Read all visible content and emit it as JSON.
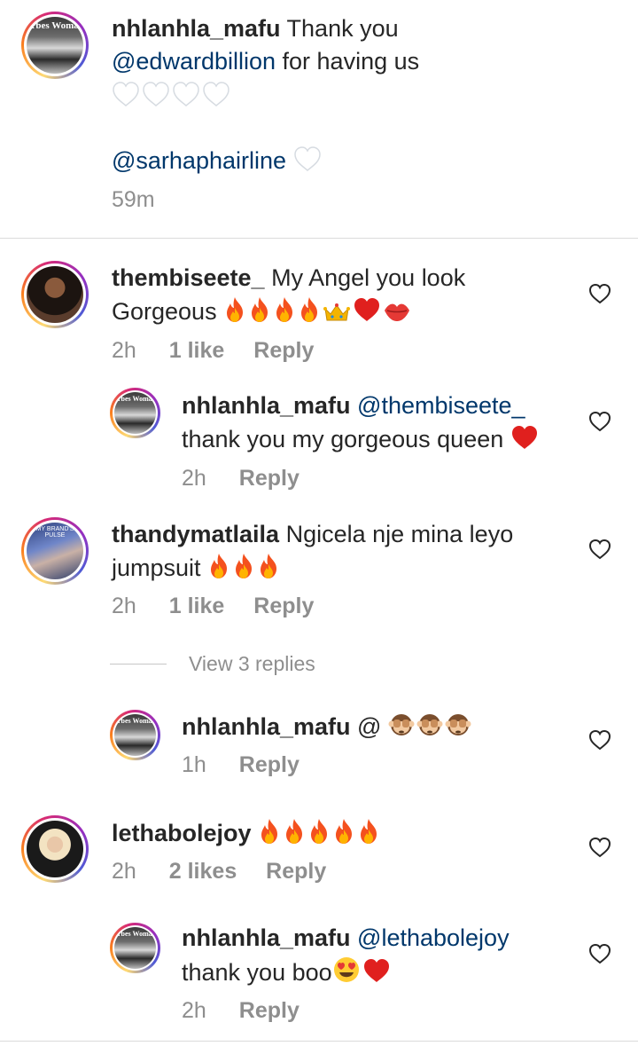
{
  "top_comment": {
    "username": "nhlanhla_mafu",
    "text_start": "Thank you",
    "mention": "@edwardbillion",
    "text_end": "for having us",
    "emoji_line": [
      "white-heart",
      "white-heart",
      "white-heart",
      "white-heart"
    ],
    "mention2": "@sarhaphairline",
    "emoji_after_mention2": "white-heart",
    "time": "59m",
    "avatar_masthead": "orbes Woman"
  },
  "comments": [
    {
      "username": "thembiseete_",
      "text_line1": "My Angel you look",
      "text_line2": "Gorgeous",
      "emojis": [
        "fire",
        "fire",
        "fire",
        "fire",
        "crown",
        "red-heart",
        "kiss"
      ],
      "time": "2h",
      "likes": "1 like",
      "reply_label": "Reply"
    },
    {
      "username": "nhlanhla_mafu",
      "mention": "@thembiseete_",
      "text_line2": "thank you my gorgeous queen",
      "emojis": [
        "red-heart"
      ],
      "time": "2h",
      "reply_label": "Reply",
      "avatar_masthead": "orbes Woman"
    },
    {
      "username": "thandymatlaila",
      "text_line1": "Ngicela nje mina leyo",
      "text_line2": "jumpsuit",
      "emojis": [
        "fire",
        "fire",
        "fire"
      ],
      "time": "2h",
      "likes": "1 like",
      "reply_label": "Reply",
      "avatar_masthead": "MY BRAND'S PULSE"
    },
    {
      "view_replies": "View 3 replies"
    },
    {
      "username": "nhlanhla_mafu",
      "text_line1": "@",
      "emojis": [
        "see-no-evil-monkey",
        "see-no-evil-monkey",
        "see-no-evil-monkey"
      ],
      "time": "1h",
      "reply_label": "Reply",
      "avatar_masthead": "orbes Woman"
    },
    {
      "username": "lethabolejoy",
      "emojis": [
        "fire",
        "fire",
        "fire",
        "fire",
        "fire"
      ],
      "time": "2h",
      "likes": "2 likes",
      "reply_label": "Reply"
    },
    {
      "username": "nhlanhla_mafu",
      "mention": "@lethabolejoy",
      "text_line2": "thank you boo",
      "emojis": [
        "heart-eyes",
        "red-heart"
      ],
      "time": "2h",
      "reply_label": "Reply",
      "avatar_masthead": "orbes Woman"
    }
  ],
  "colors": {
    "text": "#262626",
    "meta": "#8e8e8e",
    "mention": "#00376b",
    "divider": "#dbdbdb"
  },
  "icons": {
    "like": "heart-outline-icon"
  }
}
